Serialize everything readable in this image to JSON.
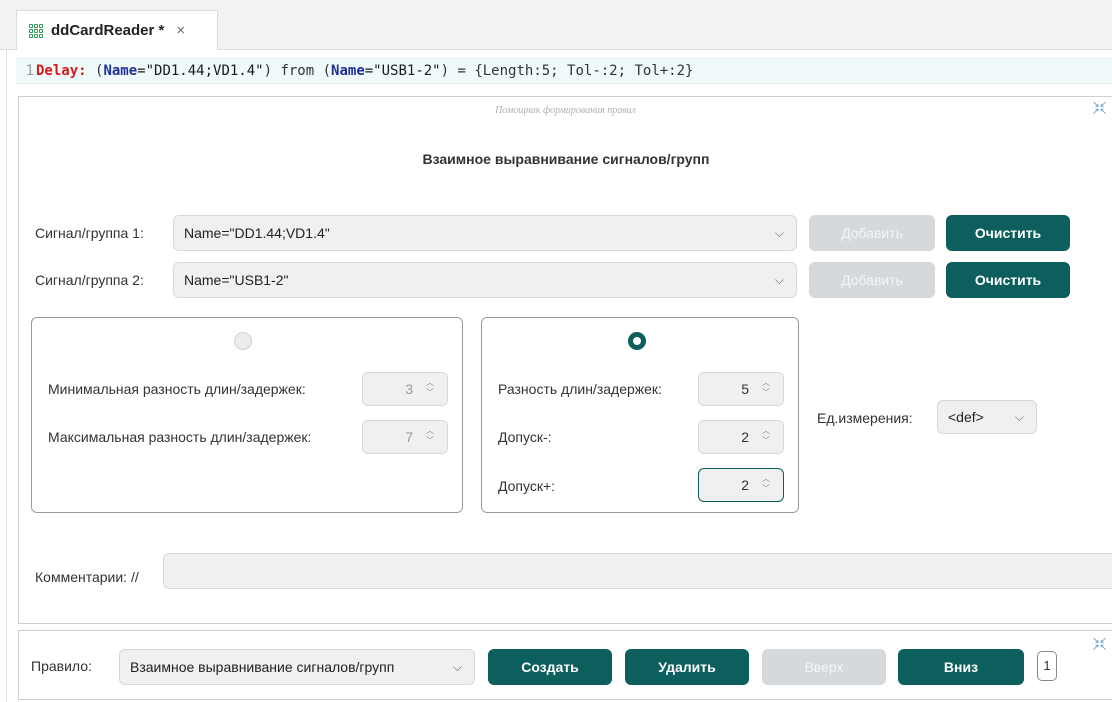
{
  "tab": {
    "title": "ddCardReader *",
    "close": "×"
  },
  "code": {
    "line_number": "1",
    "delay_kw": "Delay:",
    "open1": " (",
    "name_kw1": "Name",
    "str1": "=\"DD1.44;VD1.4\"",
    "mid": ") from (",
    "name_kw2": "Name",
    "str2": "=\"USB1-2\"",
    "tail": ") = {Length:5; Tol-:2; Tol+:2}"
  },
  "helper": {
    "caption": "Помощник формирования правил",
    "title": "Взаимное выравнивание сигналов/групп",
    "signal1": {
      "label": "Сигнал/группа 1:",
      "value": "Name=\"DD1.44;VD1.4\"",
      "add": "Добавить",
      "clear": "Очистить"
    },
    "signal2": {
      "label": "Сигнал/группа 2:",
      "value": "Name=\"USB1-2\"",
      "add": "Добавить",
      "clear": "Очистить"
    },
    "range_box": {
      "selected": false,
      "min_label": "Минимальная разность длин/задержек:",
      "min_value": "3",
      "max_label": "Максимальная разность длин/задержек:",
      "max_value": "7"
    },
    "exact_box": {
      "selected": true,
      "diff_label": "Разность длин/задержек:",
      "diff_value": "5",
      "tol_minus_label": "Допуск-:",
      "tol_minus_value": "2",
      "tol_plus_label": "Допуск+:",
      "tol_plus_value": "2"
    },
    "unit": {
      "label": "Ед.измерения:",
      "value": "<def>"
    },
    "comment": {
      "label": "Комментарии: //",
      "value": ""
    }
  },
  "bottom": {
    "rule_label": "Правило:",
    "rule_value": "Взаимное выравнивание сигналов/групп",
    "create": "Создать",
    "delete": "Удалить",
    "up": "Вверх",
    "down": "Вниз",
    "page": "1"
  },
  "colors": {
    "accent": "#0c5f5c",
    "disabled": "#d5d9dc"
  }
}
